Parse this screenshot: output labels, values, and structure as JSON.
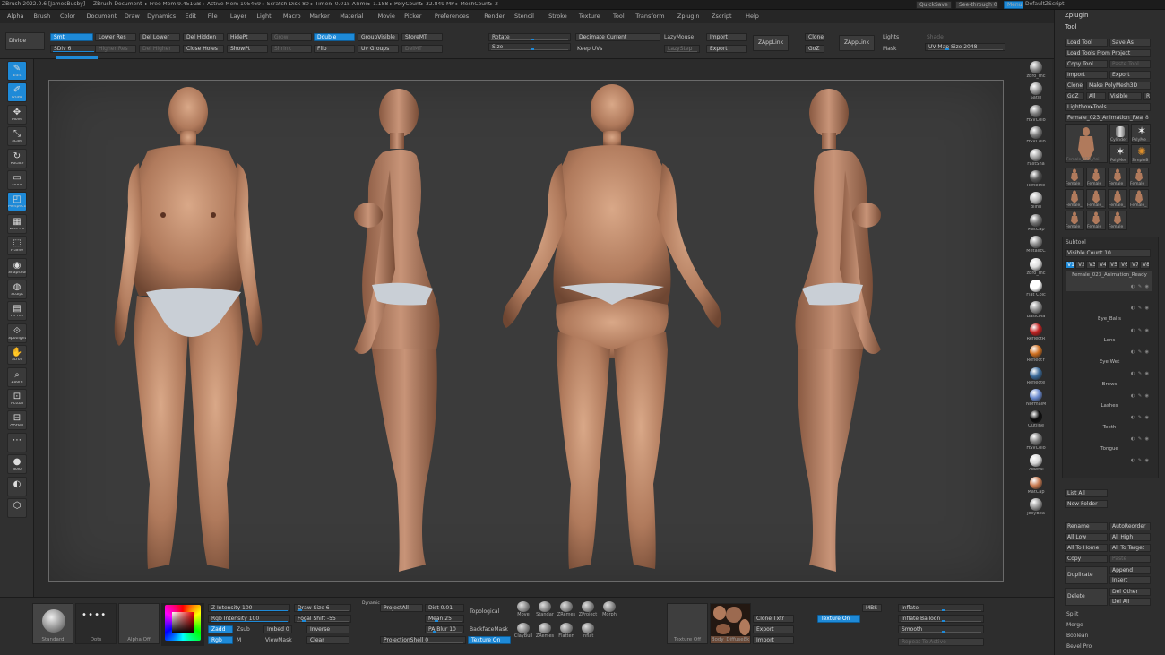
{
  "titlebar": {
    "app": "ZBrush 2022.0.6 [JamesBusby]",
    "document": "ZBrush Document",
    "stats": "▸ Free Mem 9.451GB ▸ Active Mem 105469 ▸ Scratch Disk 80 ▸ Timer▸ 0.015 ATime▸ 1.188 ▸ PolyCount▸ 32.849 MP ▸ MeshCount▸ 2",
    "quicksave": "QuickSave",
    "see_through": "See-through 0",
    "menus_btn": "Menus",
    "default_script": "DefaultZScript"
  },
  "menubar": [
    "Alpha",
    "Brush",
    "Color",
    "Document",
    "Draw",
    "Dynamics",
    "Edit",
    "File",
    "Layer",
    "Light",
    "Macro",
    "Marker",
    "Material",
    "Movie",
    "Picker",
    "Preferences",
    "Render",
    "Stencil",
    "Stroke",
    "Texture",
    "Tool",
    "Transform",
    "Zplugin",
    "Zscript",
    "Help"
  ],
  "toptools": {
    "divide": "Divide",
    "smt": "Smt",
    "sdiv": "SDiv 6",
    "lower_res": "Lower Res",
    "higher_res": "Higher Res",
    "del_lower": "Del Lower",
    "del_higher": "Del Higher",
    "del_hidden": "Del Hidden",
    "close_holes": "Close Holes",
    "hidept": "HidePt",
    "showpt": "ShowPt",
    "grow": "Grow",
    "shrink": "Shrink",
    "double": "Double",
    "flip": "Flip",
    "group_visible": "GroupVisible",
    "uv_groups": "Uv Groups",
    "store_mt": "StoreMT",
    "del_mt": "DelMT",
    "rotate": "Rotate",
    "size": "Size",
    "decimate_current": "Decimate Current",
    "keep_uvs": "Keep UVs",
    "lazymouse": "LazyMouse",
    "lazystep": "LazyStep",
    "import": "Import",
    "export": "Export",
    "zapplink": "ZAppLink",
    "clone": "Clone",
    "goz": "GoZ",
    "zapplink2": "ZAppLink",
    "lights": "Lights",
    "mask": "Mask",
    "shade": "Shade",
    "uv_map_size": "UV Map Size 2048"
  },
  "left_tools": [
    {
      "label": "Edit",
      "glyph": "✎",
      "active": true
    },
    {
      "label": "Draw",
      "glyph": "✐",
      "active": true
    },
    {
      "label": "Move",
      "glyph": "✥",
      "active": false
    },
    {
      "label": "Scale",
      "glyph": "⤡",
      "active": false
    },
    {
      "label": "Rotate",
      "glyph": "↻",
      "active": false
    },
    {
      "label": "Floor",
      "glyph": "▭",
      "active": false
    },
    {
      "label": "Perspective",
      "glyph": "◰",
      "active": true
    },
    {
      "label": "Line Fill",
      "glyph": "▦",
      "active": false
    },
    {
      "label": "Frame",
      "glyph": "⬚",
      "active": false
    },
    {
      "label": "Snapshot",
      "glyph": "◉",
      "active": false
    },
    {
      "label": "Sculpt",
      "glyph": "◍",
      "active": false
    },
    {
      "label": "Fit Tile",
      "glyph": "▤",
      "active": false
    },
    {
      "label": "Spotlight",
      "glyph": "⟐",
      "active": false
    },
    {
      "label": "Scroll",
      "glyph": "✋",
      "active": false
    },
    {
      "label": "Zoom",
      "glyph": "⌕",
      "active": false
    },
    {
      "label": "Actual",
      "glyph": "⊡",
      "active": false
    },
    {
      "label": "AAHalf",
      "glyph": "⊟",
      "active": false
    },
    {
      "label": "",
      "glyph": "⋯",
      "active": false
    },
    {
      "label": "Solo",
      "glyph": "●",
      "active": false
    },
    {
      "label": "",
      "glyph": "◐",
      "active": false
    },
    {
      "label": "",
      "glyph": "⬡",
      "active": false
    }
  ],
  "materials": [
    {
      "label": "zbro_mc",
      "color": "#8a8a8a"
    },
    {
      "label": "Satin",
      "color": "#9a9a9a"
    },
    {
      "label": "HSVColo",
      "color": "#7c7c7c"
    },
    {
      "label": "HSVColo",
      "color": "#7c7c7c"
    },
    {
      "label": "FastSha",
      "color": "#a0a0a0"
    },
    {
      "label": "Reflecte",
      "color": "#555555"
    },
    {
      "label": "Blinn",
      "color": "#b8b8b8"
    },
    {
      "label": "MatCap",
      "color": "#707070"
    },
    {
      "label": "MetallcC",
      "color": "#888888"
    },
    {
      "label": "zbro_mc",
      "color": "#dcdcdc"
    },
    {
      "label": "Flat Colc",
      "color": "#ffffff"
    },
    {
      "label": "BasicMa",
      "color": "#8e8e8e"
    },
    {
      "label": "ReflectR",
      "color": "#c02020"
    },
    {
      "label": "ReflectY",
      "color": "#d07020"
    },
    {
      "label": "Reflecte",
      "color": "#3a6a9a"
    },
    {
      "label": "NormalM",
      "color": "#6a8ad0"
    },
    {
      "label": "Outline",
      "color": "#0a0a0a"
    },
    {
      "label": "HSVColo",
      "color": "#7c7c7c"
    },
    {
      "label": "ZMetal",
      "color": "#d8d8d8"
    },
    {
      "label": "MatCap",
      "color": "#c87a50"
    },
    {
      "label": "JellyBea",
      "color": "#9a9a9a"
    }
  ],
  "rightpanel": {
    "zplugin": "Zplugin",
    "tool": "Tool",
    "load_tool": "Load Tool",
    "save_as": "Save As",
    "load_tools_from_project": "Load Tools From Project",
    "copy_tool": "Copy Tool",
    "paste_tool": "Paste Tool",
    "import": "Import",
    "export": "Export",
    "clone": "Clone",
    "make_polymesh": "Make PolyMesh3D",
    "goz": "GoZ",
    "all": "All",
    "visible": "Visible",
    "r": "R",
    "lightbox_tools": "Lightbox▸Tools",
    "current_tool": "Female_023_Animation_Read",
    "current_tool_count": "8",
    "thumb_labels": [
      "Female_023_Ani",
      "Cylinder",
      "PolyMe",
      "PolyMes",
      "SimpleB"
    ],
    "small_thumbs": [
      "Female_",
      "Female_",
      "Female_",
      "Female_",
      "Female_",
      "Female_",
      "Female_",
      "Female_",
      "Female_",
      "Female_",
      "Female_"
    ],
    "subtool_title": "Subtool",
    "visible_count": "Visible Count 10",
    "levels": [
      "V1",
      "V2",
      "V3",
      "V4",
      "V5",
      "V6",
      "V7",
      "V8"
    ],
    "subtools": [
      "Female_023_Animation_Ready",
      "",
      "Eye_Balls",
      "Lens",
      "Eye Wet",
      "Brows",
      "Lashes",
      "Teeth",
      "Tongue"
    ],
    "list_all": "List All",
    "new_folder": "New Folder",
    "rename": "Rename",
    "auto_reorder": "AutoReorder",
    "all_low": "All Low",
    "all_high": "All High",
    "all_to_home": "All To Home",
    "all_to_target": "All To Target",
    "copy": "Copy",
    "paste": "Paste",
    "duplicate": "Duplicate",
    "append": "Append",
    "insert": "Insert",
    "delete": "Delete",
    "del_other": "Del Other",
    "del_all": "Del All",
    "split": "Split",
    "merge": "Merge",
    "boolean": "Boolean",
    "bevel_pro": "Bevel Pro"
  },
  "bottom": {
    "standard": "Standard",
    "dots": "Dots",
    "alpha_off": "Alpha Off",
    "z_intensity": "Z Intensity 100",
    "rgb_intensity": "Rgb Intensity 100",
    "zadd": "Zadd",
    "zsub": "Zsub",
    "rgb": "Rgb",
    "m": "M",
    "draw_size": "Draw Size 6",
    "dynamic": "Dynamic",
    "focal_shift": "Focal Shift -55",
    "imbed": "Imbed 0",
    "inverse": "Inverse",
    "viewmask": "ViewMask",
    "clear": "Clear",
    "project_all": "ProjectAll",
    "dist": "Dist 0.01",
    "mean": "Mean 25",
    "pa_blur": "PA Blur 10",
    "projection_shell": "ProjectionShell 0",
    "topological": "Topological",
    "backface_mask": "BackfaceMask",
    "texture_on": "Texture On",
    "brushes": [
      "Move",
      "Standar",
      "ZRemes",
      "ZProject",
      "Morph",
      "ClayBuil",
      "ZRemes",
      "Flatten",
      "Inflat"
    ],
    "texture_off": "Texture Off",
    "body_diffuse": "Body_Diffuse8k",
    "clone_txtr": "Clone Txtr",
    "export": "Export",
    "import": "Import",
    "texture_on2": "Texture On",
    "mbs": "MBS",
    "inflate": "Inflate",
    "inflate_balloon": "Inflate Balloon",
    "smooth": "Smooth",
    "repeat_to_active": "Repeat To Active"
  },
  "colors": {
    "accent": "#1e8ad8",
    "panel": "#2e2e2e",
    "viewport": "#3b3b3b"
  }
}
